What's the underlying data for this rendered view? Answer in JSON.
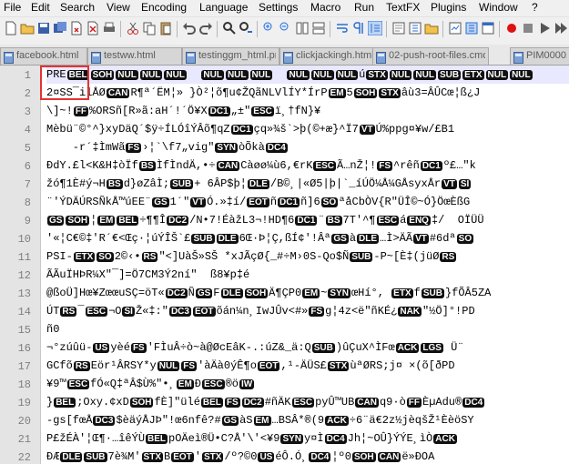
{
  "menu": [
    "File",
    "Edit",
    "Search",
    "View",
    "Encoding",
    "Language",
    "Settings",
    "Macro",
    "Run",
    "TextFX",
    "Plugins",
    "Window",
    "?"
  ],
  "tabs": [
    "facebook.html",
    "testww.html",
    "testinggm_html.png",
    "clickjackingh.html",
    "02-push-root-files.cmd",
    "PIM00001"
  ],
  "line_numbers": [
    "1",
    "2",
    "3",
    "4",
    "5",
    "6",
    "7",
    "8",
    "9",
    "10",
    "11",
    "12",
    "13",
    "14",
    "15",
    "16",
    "17",
    "18",
    "19",
    "20",
    "21",
    "22"
  ],
  "lines": [
    [
      "PRE",
      {
        "c": "BEL"
      },
      {
        "c": "SOH"
      },
      {
        "c": "NUL"
      },
      {
        "c": "NUL"
      },
      {
        "c": "NUL"
      },
      "  ",
      {
        "c": "NUL"
      },
      {
        "c": "NUL"
      },
      {
        "c": "NUL"
      },
      "  ",
      {
        "c": "NUL"
      },
      {
        "c": "NUL"
      },
      {
        "c": "NUL"
      },
      "ú",
      {
        "c": "STX"
      },
      {
        "c": "NUL"
      },
      {
        "c": "NUL"
      },
      {
        "c": "SUB"
      },
      {
        "c": "ETX"
      },
      {
        "c": "NUL"
      },
      {
        "c": "NUL"
      }
    ],
    [
      "2¤SS¯ilÅØ",
      {
        "c": "CAN"
      },
      "R¶ª´ËM¦» }Ò²¦õ¶u¢ŽQãNLVlÍY*ÍrP",
      {
        "c": "EM"
      },
      "5",
      {
        "c": "SOH"
      },
      {
        "c": "STX"
      },
      "âù3=ÂÛCœ¦ß¿J"
    ],
    [
      "\\]~!",
      {
        "c": "FF"
      },
      "%ORSñ[R»ã:aH´!´Ö¥X",
      {
        "c": "DC1"
      },
      "„±\"",
      {
        "c": "ESC"
      },
      "ï¸†fN}¥"
    ],
    [
      "Mèbü¨©°^}xyDäQ´$ÿ÷ÍLÓîÝÂõ¶qZ",
      {
        "c": "DC1"
      },
      "çq»¾š`>þ(©+æ}^Ï7",
      {
        "c": "VT"
      },
      "Ú%ppg¤¥w/£B1"
    ],
    [
      "    -r´‡ÌmWã",
      {
        "c": "FS"
      },
      "›¦`\\f7„vig\"",
      {
        "c": "SYN"
      },
      "òÕkà",
      {
        "c": "DC4"
      }
    ],
    [
      "ÐdY.£l<K&H‡òÏf",
      {
        "c": "BS"
      },
      "ÌfÌndÄ,•÷",
      {
        "c": "CAN"
      },
      "Càøø¼ù6,€rK",
      {
        "c": "ESC"
      },
      "Ã…nŽ¦!",
      {
        "c": "FS"
      },
      "^rêñ",
      {
        "c": "DC1"
      },
      "º£…\"k"
    ],
    [
      "žó¶1È#ý¬H",
      {
        "c": "BS"
      },
      "d}øZâÌ;",
      {
        "c": "SUB"
      },
      "+ 6ÂP$þ¦",
      {
        "c": "DLE"
      },
      "/B©¸|«Ø5|þ|`_íÚÖ¼Å¼GÅsyxÅr",
      {
        "c": "VT"
      },
      {
        "c": "SI"
      }
    ],
    [
      "¨'ÝDÄÚRSÑkÅ™úEE¨",
      {
        "c": "GS"
      },
      "1´\"",
      {
        "c": "VT"
      },
      "Ó.»‡í/",
      {
        "c": "EOT"
      },
      "ñ",
      {
        "c": "DC1"
      },
      "ñ]6",
      {
        "c": "SO"
      },
      "ªåCbÒV{R\"ÜÎ©~Ó}ÖœÈßG"
    ],
    [
      {
        "c": "GS"
      },
      {
        "c": "SOH"
      },
      "¦",
      {
        "c": "EM"
      },
      {
        "c": "BEL"
      },
      "÷¶¶Î",
      {
        "c": "DC2"
      },
      "/N•7!ÉàžL3¬!HD¶6",
      {
        "c": "DC1"
      },
      "¨",
      {
        "c": "BS"
      },
      "7T'^¶",
      {
        "c": "ESC"
      },
      "á",
      {
        "c": "ENQ"
      },
      "‡/  OÏÜÜ"
    ],
    [
      "'«¦C€©‡'R´€<Œç·¦úÝÎŠ`£",
      {
        "c": "SUB"
      },
      {
        "c": "DLE"
      },
      "6Œ·Þ¦Ç,ßÍ¢'!Âª",
      {
        "c": "GS"
      },
      "à",
      {
        "c": "DLE"
      },
      "…Ì>ÄÃ",
      {
        "c": "VT"
      },
      "#6dª",
      {
        "c": "SO"
      }
    ],
    [
      "PSI-",
      {
        "c": "ETX"
      },
      {
        "c": "SO"
      },
      "2©‹•",
      {
        "c": "RS"
      },
      "\"<]UàŠ»SŠ *xJÃçØ{_#÷M›0S-Qo$Ñ",
      {
        "c": "SUB"
      },
      "-P~[È‡(jüØ",
      {
        "c": "RS"
      }
    ],
    [
      "ÃÃuÏHÞR¼X\"¯]=Ö7CM3Ý2ní\"  ß8¥p‡é"
    ],
    [
      "@ßoÜ]Hœ¥ZœœuSÇ=öT«",
      {
        "c": "DC2"
      },
      "Ñ",
      {
        "c": "GS"
      },
      "F",
      {
        "c": "DLE"
      },
      {
        "c": "SOH"
      },
      "Ä¶ÇP0",
      {
        "c": "EM"
      },
      "~",
      {
        "c": "SYN"
      },
      "œHí°, ",
      {
        "c": "ETX"
      },
      "f",
      {
        "c": "SUB"
      },
      "}fÕÂ5ZA"
    ],
    [
      "ÚT",
      {
        "c": "RS"
      },
      "¯",
      {
        "c": "ESC"
      },
      "¬O",
      {
        "c": "SI"
      },
      "Ž«‡:\"",
      {
        "c": "DC3"
      },
      {
        "c": "EOT"
      },
      "õán¼n¸IwJÛv<#»",
      {
        "c": "FS"
      },
      "g¦4z<ë\"ñKÉ¿",
      {
        "c": "NAK"
      },
      "\"½Ö]°!PD"
    ],
    [
      "ñ0"
    ],
    [
      "¬°zúûü-",
      {
        "c": "US"
      },
      "yèé",
      {
        "c": "FS"
      },
      "'FÌuÂ÷ò~à@ØcEâK-.:úZ&_ä:Q",
      {
        "c": "SUB"
      },
      ")ûÇuX^ÌFœ",
      {
        "c": "ACK"
      },
      {
        "c": "LGS"
      },
      " Ü¨"
    ],
    [
      "GCfõ",
      {
        "c": "RS"
      },
      "Eör¹ÂRSY*y",
      {
        "c": "NUL"
      },
      {
        "c": "FS"
      },
      "'àÄà0ýÊ¶o",
      {
        "c": "EOT"
      },
      ",¹-ÄÜS£",
      {
        "c": "STX"
      },
      "ùªØRS;j¤ ×(õ[ðPD"
    ],
    [
      "¥9™",
      {
        "c": "ESC"
      },
      "fÓ«Q‡ªÂ$Ù%\"•¸",
      {
        "c": "EM"
      },
      "Ð",
      {
        "c": "ESC"
      },
      "®ö",
      {
        "c": "IW"
      }
    ],
    [
      "}",
      {
        "c": "BEL"
      },
      ";Oxy.¢xD",
      {
        "c": "SOH"
      },
      "fÈ]\"ülé",
      {
        "c": "BEL"
      },
      {
        "c": "FS"
      },
      {
        "c": "DC2"
      },
      "#ñÄK",
      {
        "c": "ESC"
      },
      "pyÛ™UB",
      {
        "c": "CAN"
      },
      "q9·ò",
      {
        "c": "FF"
      },
      "ÈµAdu®",
      {
        "c": "DC4"
      }
    ],
    [
      "-gs[fœÅ",
      {
        "c": "DC3"
      },
      "$èäýÅJÞ\"!œ6nfê?#",
      {
        "c": "GS"
      },
      "àS",
      {
        "c": "EM"
      },
      "…BSÂ*®(9",
      {
        "c": "ACK"
      },
      "÷6¨ä€2z½jèqšŽ¹ÈèöSY"
    ],
    [
      "P£žÉÀ'¦Œ¶·…îêÝÙ",
      {
        "c": "BEL"
      },
      "pOÄeì®Ü•C?Å'\\'<¥9",
      {
        "c": "SYN"
      },
      "y¤Ì",
      {
        "c": "DC4"
      },
      "Jh¦~OÛ}ÝÝE¸ìÒ",
      {
        "c": "ACK"
      }
    ],
    [
      "ÐÆ",
      {
        "c": "DLE"
      },
      {
        "c": "SUB"
      },
      "7è¾M'",
      {
        "c": "STX"
      },
      "B",
      {
        "c": "EOT"
      },
      "'",
      {
        "c": "STX"
      },
      "/º?©0",
      {
        "c": "US"
      },
      "éÔ.Ó¸",
      {
        "c": "DC4"
      },
      "¦º0",
      {
        "c": "SOH"
      },
      {
        "c": "CAN"
      },
      "ë»ÐOA"
    ]
  ]
}
